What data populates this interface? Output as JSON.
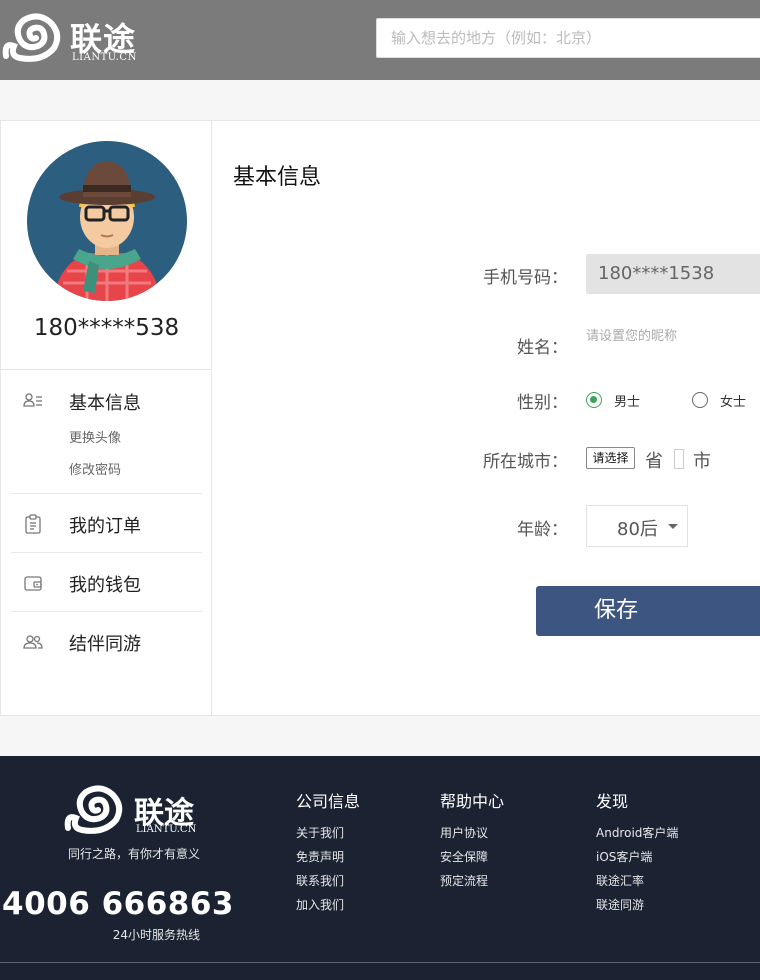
{
  "header": {
    "brand": "联途",
    "brand_sub": "LIANTU.CN",
    "search_placeholder": "输入想去的地方（例如：北京）"
  },
  "sidebar": {
    "username": "180*****538",
    "menu": [
      {
        "label": "基本信息",
        "icon": "user-list-icon"
      },
      {
        "label": "我的订单",
        "icon": "clipboard-icon"
      },
      {
        "label": "我的钱包",
        "icon": "wallet-icon"
      },
      {
        "label": "结伴同游",
        "icon": "users-icon"
      }
    ],
    "sublinks": [
      "更换头像",
      "修改密码"
    ]
  },
  "form": {
    "title": "基本信息",
    "phone_label": "手机号码：",
    "phone_value": "180****1538",
    "name_label": "姓名：",
    "name_placeholder": "请设置您的昵称",
    "gender_label": "性别：",
    "gender_male": "男士",
    "gender_female": "女士",
    "city_label": "所在城市：",
    "city_select": "请选择",
    "province": "省",
    "city": "市",
    "age_label": "年龄：",
    "age_value": "80后",
    "save_label": "保存"
  },
  "footer": {
    "brand": "联途",
    "brand_sub": "LIANTU.CN",
    "slogan": "同行之路，有你才有意义",
    "hotline": "4006 666863",
    "hotline_label": "24小时服务热线",
    "columns": [
      {
        "title": "公司信息",
        "links": [
          "关于我们",
          "免责声明",
          "联系我们",
          "加入我们"
        ]
      },
      {
        "title": "帮助中心",
        "links": [
          "用户协议",
          "安全保障",
          "预定流程"
        ]
      },
      {
        "title": "发现",
        "links": [
          "Android客户端",
          "iOS客户端",
          "联途汇率",
          "联途同游"
        ]
      }
    ]
  },
  "colors": {
    "header_bg": "#7b7b7b",
    "footer_bg": "#1b2333",
    "save_button": "#3c5581",
    "radio_active": "#3aa355"
  }
}
